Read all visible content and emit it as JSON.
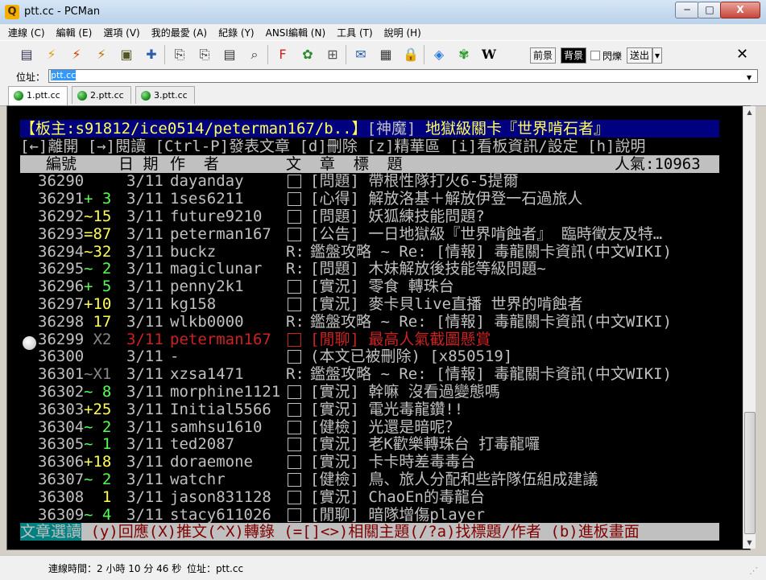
{
  "window": {
    "title": "ptt.cc - PCMan",
    "app_icon_letter": "Q",
    "min": "─",
    "max": "□",
    "close": "X"
  },
  "menu": [
    "連線 (C)",
    "編輯 (E)",
    "選項 (V)",
    "我的最愛 (A)",
    "紀錄 (Y)",
    "ANSI編輯 (N)",
    "工具 (T)",
    "說明 (H)"
  ],
  "toolbar": {
    "icons": [
      "▤",
      "⚡",
      "⚡",
      "⚡",
      "▣",
      "✚",
      "⎘",
      "⎘",
      "▤",
      "⌕",
      "F",
      "✿",
      "⊞",
      "✉",
      "▦",
      "🔒",
      "◈",
      "✾",
      "W"
    ],
    "fg_label": "前景",
    "bg_label": "背景",
    "blink_label": "閃爍",
    "send_label": "送出",
    "close_glyph": "✕"
  },
  "address": {
    "label": "位址：",
    "value": "ptt.cc"
  },
  "tabs": [
    {
      "label": "1.ptt.cc",
      "active": true
    },
    {
      "label": "2.ptt.cc",
      "active": false
    },
    {
      "label": "3.ptt.cc",
      "active": false
    }
  ],
  "terminal": {
    "header": {
      "moderators": "【板主:s91812/ice0514/peterman167/b..】",
      "board": "[神魔]",
      "board_title": "地獄級關卡『世界啃石者』"
    },
    "help": "[←]離開 [→]閱讀 [Ctrl-P]發表文章 [d]刪除 [z]精華區 [i]看板資訊/設定 [h]說明",
    "colhdr": {
      "num": "編號",
      "date": "日 期",
      "author": "作  者",
      "title": "文  章  標  題",
      "popularity": "人氣:10963"
    },
    "rows": [
      {
        "num": "36290",
        "mark": "",
        "date": "3/11",
        "author": "dayanday",
        "prefix": "□",
        "title": "[問題] 帶根性隊打火6-5提爾"
      },
      {
        "num": "36291",
        "mark": "+ 3",
        "date": "3/11",
        "author": "1ses6211",
        "prefix": "□",
        "title": "[心得] 解放洛基＋解放伊登一石過旅人"
      },
      {
        "num": "36292",
        "mark": "~15",
        "date": "3/11",
        "author": "future9210",
        "prefix": "□",
        "title": "[問題] 妖狐練技能問題?"
      },
      {
        "num": "36293",
        "mark": "=87",
        "date": "3/11",
        "author": "peterman167",
        "prefix": "□",
        "title": "[公告] 一日地獄級『世界啃蝕者』 臨時徵友及特…"
      },
      {
        "num": "36294",
        "mark": "~32",
        "date": "3/11",
        "author": "buckz",
        "prefix": "R:",
        "title": "鑑盤攻略 ~ Re: [情報] 毒龍關卡資訊(中文WIKI)"
      },
      {
        "num": "36295",
        "mark": "~ 2",
        "date": "3/11",
        "author": "magiclunar",
        "prefix": "R:",
        "title": "[問題] 木妹解放後技能等級問題~"
      },
      {
        "num": "36296",
        "mark": "+ 5",
        "date": "3/11",
        "author": "penny2k1",
        "prefix": "□",
        "title": "[實況] 零食 轉珠台"
      },
      {
        "num": "36297",
        "mark": "+10",
        "date": "3/11",
        "author": "kg158",
        "prefix": "□",
        "title": "[實況] 麥卡貝live直播 世界的啃蝕者"
      },
      {
        "num": "36298",
        "mark": " 17",
        "date": "3/11",
        "author": "wlkb0000",
        "prefix": "R:",
        "title": "鑑盤攻略 ~ Re: [情報] 毒龍關卡資訊(中文WIKI)"
      },
      {
        "num": "36299",
        "mark": " X2",
        "date": "3/11",
        "author": "peterman167",
        "prefix": "□",
        "title": "[閒聊] 最高人氣截圖懸賞",
        "red": true
      },
      {
        "num": "36300",
        "mark": "",
        "date": "3/11",
        "author": "-",
        "prefix": "□",
        "title": "(本文已被刪除) [x850519]"
      },
      {
        "num": "36301",
        "mark": "~X1",
        "date": "3/11",
        "author": "xzsa1471",
        "prefix": "R:",
        "title": "鑑盤攻略 ~ Re: [情報] 毒龍關卡資訊(中文WIKI)"
      },
      {
        "num": "36302",
        "mark": "~ 8",
        "date": "3/11",
        "author": "morphine1121",
        "prefix": "□",
        "title": "[實況] 幹嘛 沒看過變態嗎"
      },
      {
        "num": "36303",
        "mark": "+25",
        "date": "3/11",
        "author": "Initial5566",
        "prefix": "□",
        "title": "[實況] 電光毒龍鑽!!"
      },
      {
        "num": "36304",
        "mark": "~ 2",
        "date": "3/11",
        "author": "samhsu1610",
        "prefix": "□",
        "title": "[健檢] 光還是暗呢？"
      },
      {
        "num": "36305",
        "mark": "~ 1",
        "date": "3/11",
        "author": "ted2087",
        "prefix": "□",
        "title": "[實況] 老K歡樂轉珠台 打毒龍囉"
      },
      {
        "num": "36306",
        "mark": "+18",
        "date": "3/11",
        "author": "doraemone",
        "prefix": "□",
        "title": "[實況] 卡卡時差毒毒台"
      },
      {
        "num": "36307",
        "mark": "~ 2",
        "date": "3/11",
        "author": "watchr",
        "prefix": "□",
        "title": "[健檢] 鳥、旅人分配和些許隊伍組成建議"
      },
      {
        "num": "36308",
        "mark": "  1",
        "date": "3/11",
        "author": "jason831128",
        "prefix": "□",
        "title": "[實況] ChaoEn的毒龍台"
      },
      {
        "num": "36309",
        "mark": "~ 4",
        "date": "3/11",
        "author": "stacy611026",
        "prefix": "□",
        "title": "[閒聊] 暗隊增傷player"
      }
    ],
    "footer": {
      "mode": "文章選讀",
      "hint": " (y)回應(X)推文(^X)轉錄 (=[]<>)相關主題(/?a)找標題/作者 (b)進板畫面"
    }
  },
  "status": {
    "time": "連線時間：2 小時 10 分 46 秒",
    "addr": "位址：ptt.cc"
  },
  "colors": {
    "terminal_bg": "#000000",
    "header_bg": "#000080",
    "header_fg": "#ffff55",
    "footer_mode_bg": "#008080",
    "footer_hint_fg": "#800000"
  }
}
